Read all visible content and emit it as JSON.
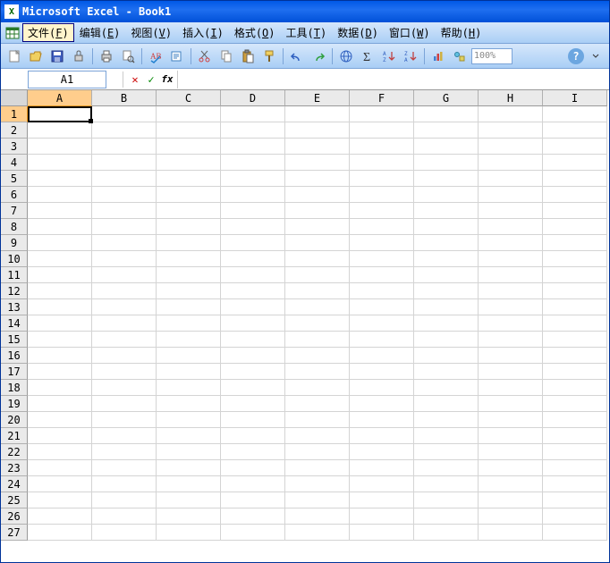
{
  "title": "Microsoft Excel - Book1",
  "app_icon_letter": "X",
  "menus": [
    {
      "label": "文件",
      "key": "F",
      "active": true
    },
    {
      "label": "编辑",
      "key": "E",
      "active": false
    },
    {
      "label": "视图",
      "key": "V",
      "active": false
    },
    {
      "label": "插入",
      "key": "I",
      "active": false
    },
    {
      "label": "格式",
      "key": "O",
      "active": false
    },
    {
      "label": "工具",
      "key": "T",
      "active": false
    },
    {
      "label": "数据",
      "key": "D",
      "active": false
    },
    {
      "label": "窗口",
      "key": "W",
      "active": false
    },
    {
      "label": "帮助",
      "key": "H",
      "active": false
    }
  ],
  "toolbar": {
    "zoom": "100%"
  },
  "formula_bar": {
    "name_box": "A1",
    "cancel": "✕",
    "confirm": "✓",
    "fx": "fx"
  },
  "grid": {
    "columns": [
      "A",
      "B",
      "C",
      "D",
      "E",
      "F",
      "G",
      "H",
      "I"
    ],
    "rows": [
      1,
      2,
      3,
      4,
      5,
      6,
      7,
      8,
      9,
      10,
      11,
      12,
      13,
      14,
      15,
      16,
      17,
      18,
      19,
      20,
      21,
      22,
      23,
      24,
      25,
      26,
      27
    ],
    "selected_col": "A",
    "selected_row": 1
  }
}
